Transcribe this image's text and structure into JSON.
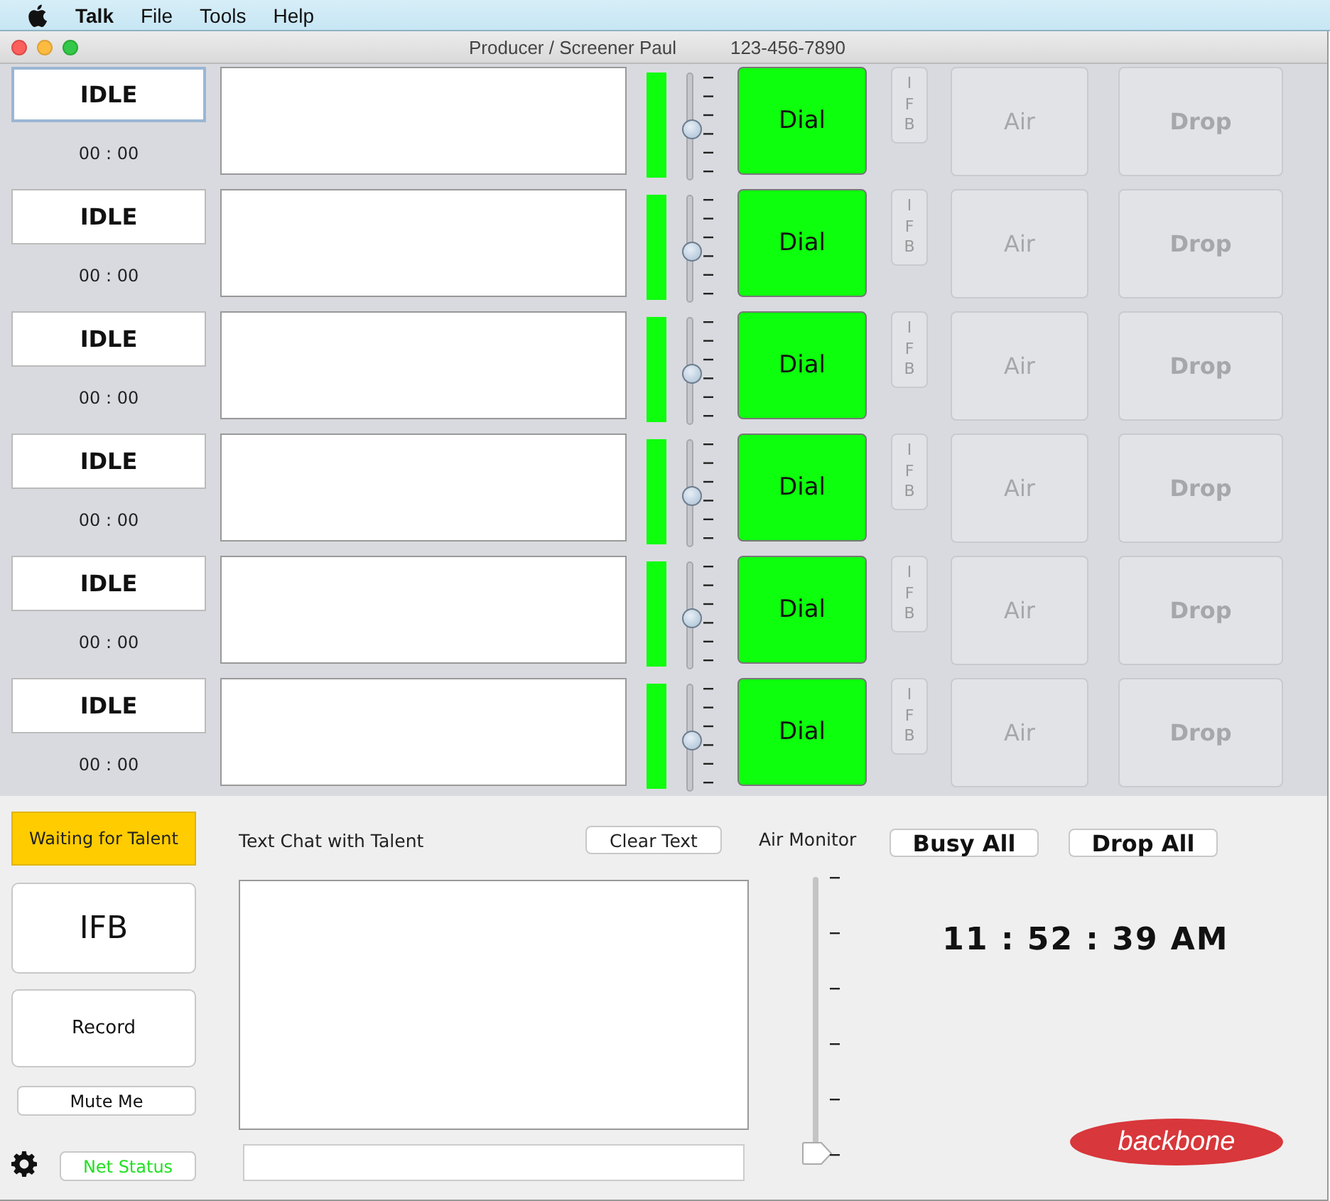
{
  "menu_bar": {
    "app_name": "Talk",
    "items": [
      "File",
      "Tools",
      "Help"
    ]
  },
  "window": {
    "title": "Producer / Screener Paul",
    "phone": "123-456-7890"
  },
  "lines": [
    {
      "status": "IDLE",
      "timer": "00 : 00",
      "meter": {
        "level": 1
      },
      "fader": {
        "level": 0.5
      },
      "dial": "Dial",
      "ifb": {
        "label": "IFB",
        "disabled": true
      },
      "air": {
        "label": "Air",
        "disabled": true
      },
      "drop": {
        "label": "Drop",
        "disabled": true
      }
    },
    {
      "status": "IDLE",
      "timer": "00 : 00",
      "meter": {
        "level": 1
      },
      "fader": {
        "level": 0.5
      },
      "dial": "Dial",
      "ifb": {
        "label": "IFB",
        "disabled": true
      },
      "air": {
        "label": "Air",
        "disabled": true
      },
      "drop": {
        "label": "Drop",
        "disabled": true
      }
    },
    {
      "status": "IDLE",
      "timer": "00 : 00",
      "meter": {
        "level": 1
      },
      "fader": {
        "level": 0.5
      },
      "dial": "Dial",
      "ifb": {
        "label": "IFB",
        "disabled": true
      },
      "air": {
        "label": "Air",
        "disabled": true
      },
      "drop": {
        "label": "Drop",
        "disabled": true
      }
    },
    {
      "status": "IDLE",
      "timer": "00 : 00",
      "meter": {
        "level": 1
      },
      "fader": {
        "level": 0.5
      },
      "dial": "Dial",
      "ifb": {
        "label": "IFB",
        "disabled": true
      },
      "air": {
        "label": "Air",
        "disabled": true
      },
      "drop": {
        "label": "Drop",
        "disabled": true
      }
    },
    {
      "status": "IDLE",
      "timer": "00 : 00",
      "meter": {
        "level": 1
      },
      "fader": {
        "level": 0.5
      },
      "dial": "Dial",
      "ifb": {
        "label": "IFB",
        "disabled": true
      },
      "air": {
        "label": "Air",
        "disabled": true
      },
      "drop": {
        "label": "Drop",
        "disabled": true
      }
    },
    {
      "status": "IDLE",
      "timer": "00 : 00",
      "meter": {
        "level": 1
      },
      "fader": {
        "level": 0.5
      },
      "dial": "Dial",
      "ifb": {
        "label": "IFB",
        "disabled": true
      },
      "air": {
        "label": "Air",
        "disabled": true
      },
      "drop": {
        "label": "Drop",
        "disabled": true
      }
    }
  ],
  "talent_status": "Waiting for Talent",
  "ifb_button": "IFB",
  "record_button": "Record",
  "mute_button": "Mute Me",
  "net_status": "Net Status",
  "chat": {
    "title": "Text Chat with Talent",
    "clear_button": "Clear Text"
  },
  "air_monitor": {
    "label": "Air Monitor",
    "level": 0
  },
  "busy_all": "Busy All",
  "drop_all": "Drop All",
  "clock": "11 : 52 : 39 AM",
  "logo": "backbone"
}
